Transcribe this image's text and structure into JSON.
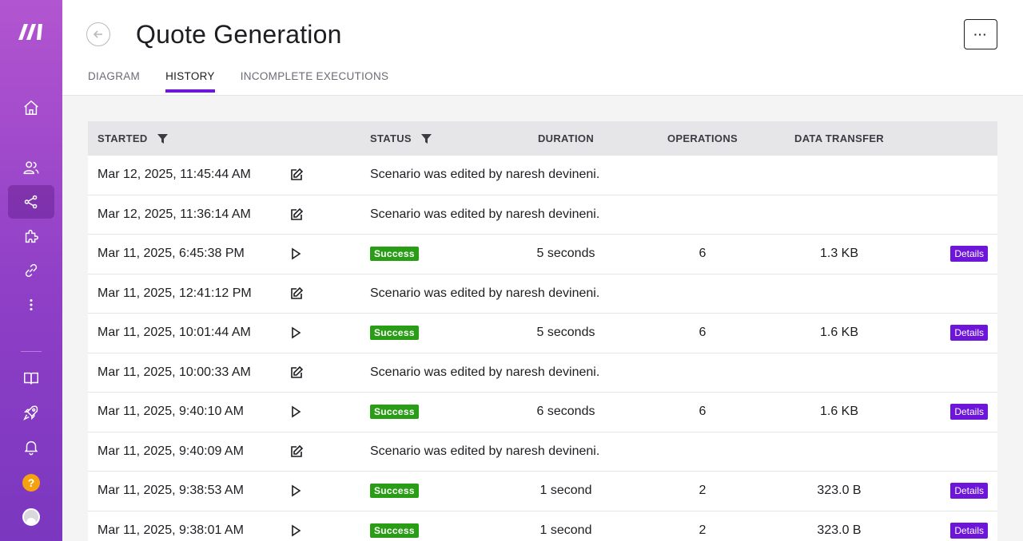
{
  "app": {
    "title": "Quote Generation",
    "more_label": "···"
  },
  "tabs": [
    {
      "label": "DIAGRAM",
      "active": false
    },
    {
      "label": "HISTORY",
      "active": true
    },
    {
      "label": "INCOMPLETE EXECUTIONS",
      "active": false
    }
  ],
  "sidebar": {
    "items": [
      {
        "icon": "home-icon"
      },
      {
        "icon": "users-icon"
      },
      {
        "icon": "share-icon",
        "active": true
      },
      {
        "icon": "puzzle-icon"
      },
      {
        "icon": "link-icon"
      },
      {
        "icon": "more-vertical-icon"
      },
      {
        "icon": "book-icon"
      },
      {
        "icon": "rocket-icon"
      },
      {
        "icon": "bell-icon"
      },
      {
        "icon": "help-icon",
        "label": "?"
      },
      {
        "icon": "avatar"
      }
    ]
  },
  "table": {
    "headers": {
      "started": "STARTED",
      "status": "STATUS",
      "duration": "DURATION",
      "operations": "OPERATIONS",
      "data_transfer": "DATA TRANSFER"
    },
    "rows": [
      {
        "started": "Mar 12, 2025, 11:45:44 AM",
        "type": "edit",
        "message": "Scenario was edited by naresh devineni."
      },
      {
        "started": "Mar 12, 2025, 11:36:14 AM",
        "type": "edit",
        "message": "Scenario was edited by naresh devineni."
      },
      {
        "started": "Mar 11, 2025, 6:45:38 PM",
        "type": "run",
        "status": "Success",
        "duration": "5 seconds",
        "operations": "6",
        "data_transfer": "1.3 KB",
        "action": "Details"
      },
      {
        "started": "Mar 11, 2025, 12:41:12 PM",
        "type": "edit",
        "message": "Scenario was edited by naresh devineni."
      },
      {
        "started": "Mar 11, 2025, 10:01:44 AM",
        "type": "run",
        "status": "Success",
        "duration": "5 seconds",
        "operations": "6",
        "data_transfer": "1.6 KB",
        "action": "Details"
      },
      {
        "started": "Mar 11, 2025, 10:00:33 AM",
        "type": "edit",
        "message": "Scenario was edited by naresh devineni."
      },
      {
        "started": "Mar 11, 2025, 9:40:10 AM",
        "type": "run",
        "status": "Success",
        "duration": "6 seconds",
        "operations": "6",
        "data_transfer": "1.6 KB",
        "action": "Details"
      },
      {
        "started": "Mar 11, 2025, 9:40:09 AM",
        "type": "edit",
        "message": "Scenario was edited by naresh devineni."
      },
      {
        "started": "Mar 11, 2025, 9:38:53 AM",
        "type": "run",
        "status": "Success",
        "duration": "1 second",
        "operations": "2",
        "data_transfer": "323.0 B",
        "action": "Details"
      },
      {
        "started": "Mar 11, 2025, 9:38:01 AM",
        "type": "run",
        "status": "Success",
        "duration": "1 second",
        "operations": "2",
        "data_transfer": "323.0 B",
        "action": "Details"
      }
    ]
  },
  "colors": {
    "accent": "#6d16d9",
    "success": "#2a9d16",
    "sidebar_top": "#b255d0",
    "sidebar_bottom": "#7b37bf"
  }
}
